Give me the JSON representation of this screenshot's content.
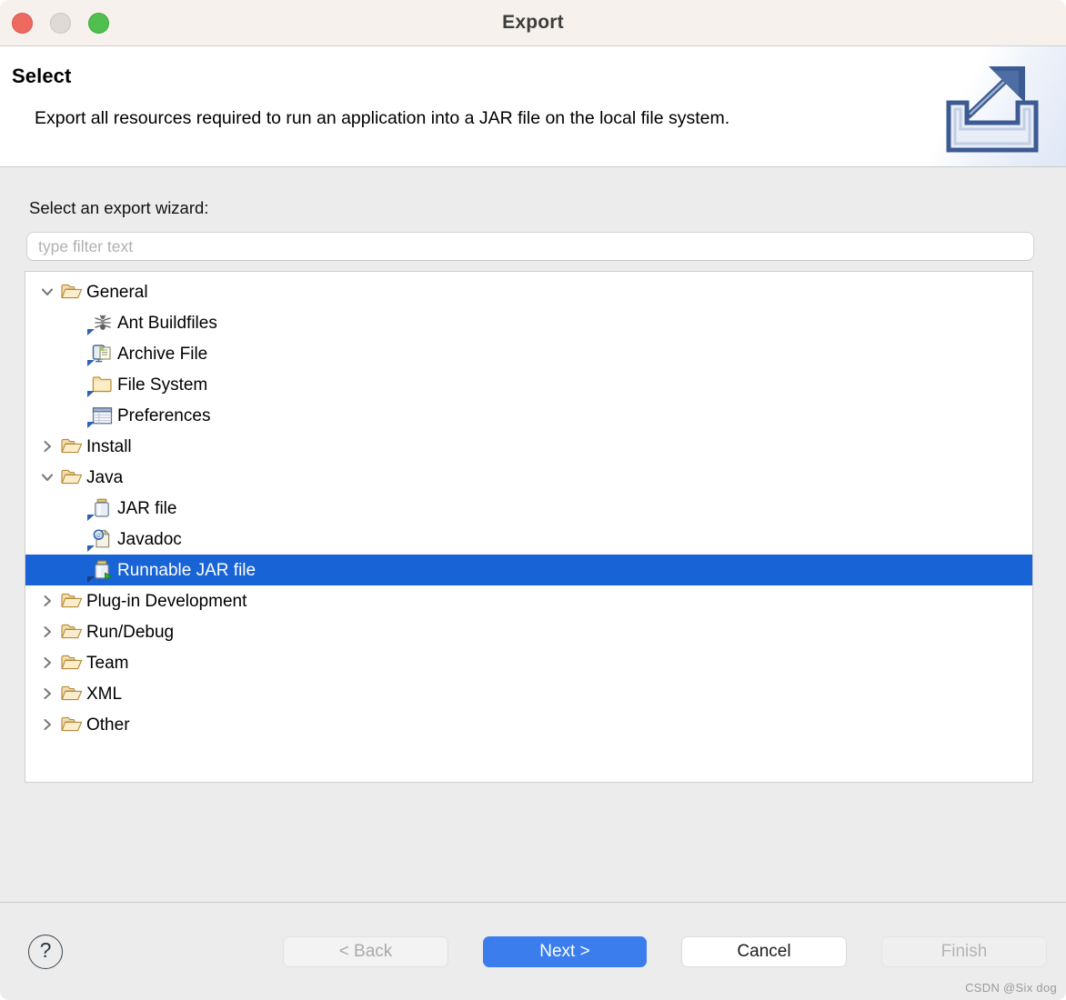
{
  "window": {
    "title": "Export",
    "traffic_lights": [
      {
        "name": "close",
        "color": "#ec6a5f"
      },
      {
        "name": "minimize",
        "color": "#dedad7"
      },
      {
        "name": "zoom",
        "color": "#4fbf4f"
      }
    ]
  },
  "banner": {
    "title": "Select",
    "description": "Export all resources required to run an application into a JAR file on the local file system.",
    "icon": "export-wizard-banner-icon"
  },
  "main": {
    "select_label": "Select an export wizard:",
    "filter": {
      "value": "",
      "placeholder": "type filter text"
    },
    "tree": [
      {
        "label": "General",
        "level": 0,
        "expanded": true,
        "icon": "open-folder-icon",
        "selected": false
      },
      {
        "label": "Ant Buildfiles",
        "level": 1,
        "expanded": null,
        "icon": "ant-icon",
        "selected": false
      },
      {
        "label": "Archive File",
        "level": 1,
        "expanded": null,
        "icon": "archive-file-icon",
        "selected": false
      },
      {
        "label": "File System",
        "level": 1,
        "expanded": null,
        "icon": "folder-icon",
        "selected": false
      },
      {
        "label": "Preferences",
        "level": 1,
        "expanded": null,
        "icon": "preferences-icon",
        "selected": false
      },
      {
        "label": "Install",
        "level": 0,
        "expanded": false,
        "icon": "open-folder-icon",
        "selected": false
      },
      {
        "label": "Java",
        "level": 0,
        "expanded": true,
        "icon": "open-folder-icon",
        "selected": false
      },
      {
        "label": "JAR file",
        "level": 1,
        "expanded": null,
        "icon": "jar-icon",
        "selected": false
      },
      {
        "label": "Javadoc",
        "level": 1,
        "expanded": null,
        "icon": "javadoc-icon",
        "selected": false
      },
      {
        "label": "Runnable JAR file",
        "level": 1,
        "expanded": null,
        "icon": "runnable-jar-icon",
        "selected": true
      },
      {
        "label": "Plug-in Development",
        "level": 0,
        "expanded": false,
        "icon": "open-folder-icon",
        "selected": false
      },
      {
        "label": "Run/Debug",
        "level": 0,
        "expanded": false,
        "icon": "open-folder-icon",
        "selected": false
      },
      {
        "label": "Team",
        "level": 0,
        "expanded": false,
        "icon": "open-folder-icon",
        "selected": false
      },
      {
        "label": "XML",
        "level": 0,
        "expanded": false,
        "icon": "open-folder-icon",
        "selected": false
      },
      {
        "label": "Other",
        "level": 0,
        "expanded": false,
        "icon": "open-folder-icon",
        "selected": false
      }
    ],
    "selection_color": "#1863d6",
    "edge_chevron": "❮"
  },
  "footer": {
    "help_label": "?",
    "back_label": "< Back",
    "next_label": "Next >",
    "cancel_label": "Cancel",
    "finish_label": "Finish",
    "next_color": "#3b7ded",
    "watermark": "CSDN @Six dog"
  }
}
